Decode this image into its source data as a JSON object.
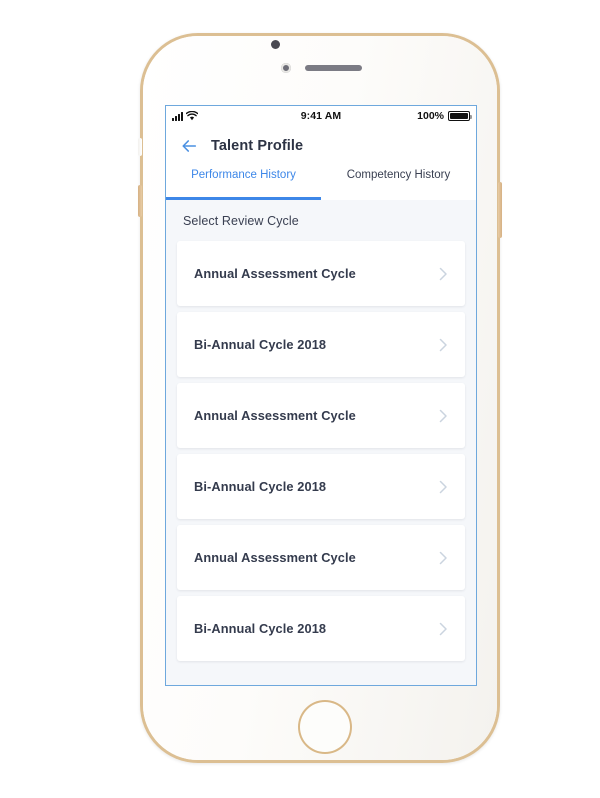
{
  "device": {
    "name": "smartphone-mockup",
    "frame_color": "#dcbf93",
    "body_color": "#fdfdfb"
  },
  "status_bar": {
    "signal_icon": "signal-bars-icon",
    "wifi_icon": "wifi-icon",
    "time": "9:41 AM",
    "battery_percent": "100%",
    "battery_icon": "battery-full-icon"
  },
  "nav": {
    "back_icon": "back-arrow-icon",
    "title": "Talent Profile"
  },
  "tabs": [
    {
      "label": "Performance History",
      "active": true
    },
    {
      "label": "Competency History",
      "active": false
    }
  ],
  "content": {
    "section_label": "Select Review Cycle",
    "items": [
      {
        "label": "Annual Assessment Cycle",
        "chevron": "chevron-right-icon"
      },
      {
        "label": "Bi-Annual Cycle 2018",
        "chevron": "chevron-right-icon"
      },
      {
        "label": "Annual Assessment Cycle",
        "chevron": "chevron-right-icon"
      },
      {
        "label": "Bi-Annual Cycle 2018",
        "chevron": "chevron-right-icon"
      },
      {
        "label": "Annual Assessment Cycle",
        "chevron": "chevron-right-icon"
      },
      {
        "label": "Bi-Annual Cycle 2018",
        "chevron": "chevron-right-icon"
      }
    ]
  },
  "colors": {
    "accent": "#3d87e8",
    "screen_background": "#f5f7fa",
    "card_background": "#ffffff",
    "text_primary": "#343b4d",
    "chevron": "#c9d2de"
  }
}
